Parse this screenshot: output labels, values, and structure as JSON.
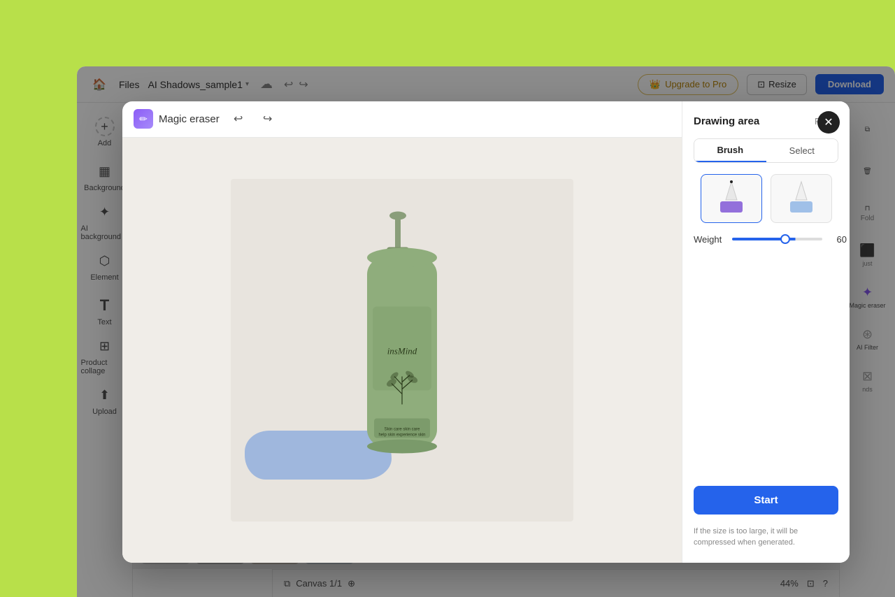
{
  "app": {
    "background_color": "#b8e04a",
    "title": "AI Shadows_sample1"
  },
  "topbar": {
    "home_icon": "🏠",
    "files_label": "Files",
    "filename": "AI Shadows_sample1",
    "chevron": "▾",
    "upgrade_label": "Upgrade to Pro",
    "resize_label": "Resize",
    "download_label": "Download"
  },
  "sidebar": {
    "items": [
      {
        "id": "add",
        "label": "Add",
        "icon": "+"
      },
      {
        "id": "background",
        "label": "Background",
        "icon": "▦"
      },
      {
        "id": "ai-background",
        "label": "AI background",
        "icon": "✦"
      },
      {
        "id": "element",
        "label": "Element",
        "icon": "⬡"
      },
      {
        "id": "text",
        "label": "Text",
        "icon": "T"
      },
      {
        "id": "product-collage",
        "label": "Product collage",
        "icon": "⊞"
      },
      {
        "id": "upload",
        "label": "Upload",
        "icon": "⬆"
      }
    ]
  },
  "right_panel": {
    "items": [
      {
        "id": "layers",
        "icon": "⧉",
        "label": ""
      },
      {
        "id": "delete",
        "icon": "🗑",
        "label": ""
      },
      {
        "id": "fold",
        "icon": "⊓",
        "label": "Fold"
      },
      {
        "id": "adjust",
        "label": "just",
        "icon": "⚙"
      },
      {
        "id": "magic-eraser",
        "label": "Magic eraser",
        "icon": "✦"
      },
      {
        "id": "ai-filter",
        "label": "AI Filter",
        "icon": "⊛"
      },
      {
        "id": "backgrounds",
        "label": "nds",
        "icon": "⊠"
      }
    ]
  },
  "canvas": {
    "label": "Canvas 1/1",
    "zoom": "44%"
  },
  "modal": {
    "title": "Magic eraser",
    "undo_icon": "↩",
    "redo_icon": "↪",
    "close_icon": "✕",
    "panel": {
      "drawing_area_label": "Drawing area",
      "reset_label": "Reset",
      "brush_label": "Brush",
      "select_label": "Select",
      "weight_label": "Weight",
      "weight_value": "60",
      "start_label": "Start",
      "note": "If the size is too large, it will be compressed when generated."
    }
  },
  "product": {
    "brand": "insMind"
  }
}
